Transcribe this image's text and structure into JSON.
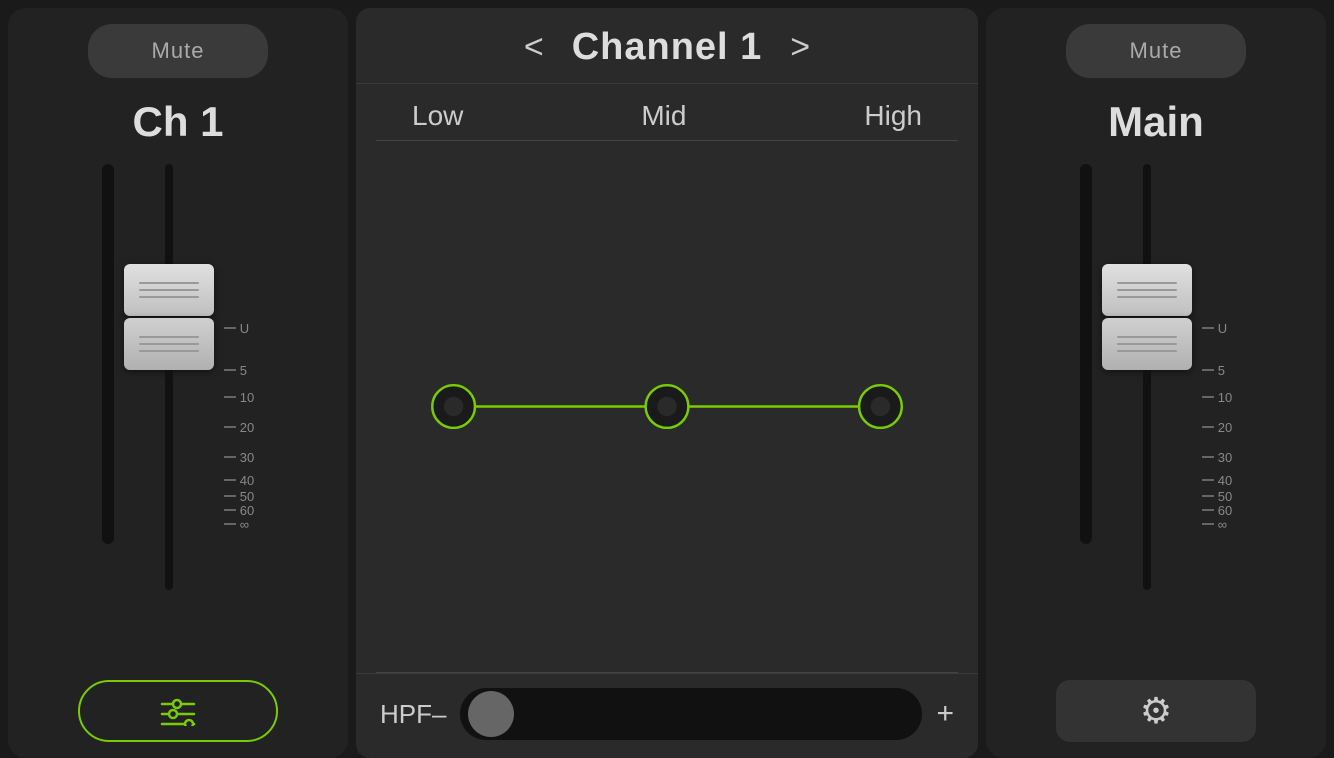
{
  "left_panel": {
    "mute_label": "Mute",
    "channel_label": "Ch 1",
    "eq_button_label": "|||",
    "scale_marks": [
      "U",
      "5",
      "10",
      "20",
      "30",
      "40",
      "50",
      "60",
      "∞"
    ]
  },
  "center_panel": {
    "prev_arrow": "<",
    "next_arrow": ">",
    "channel_title": "Channel 1",
    "eq_bands": {
      "low_label": "Low",
      "mid_label": "Mid",
      "high_label": "High"
    },
    "hpf_label": "HPF–",
    "hpf_plus": "+"
  },
  "right_panel": {
    "mute_label": "Mute",
    "channel_label": "Main",
    "gear_button_label": "⚙",
    "scale_marks": [
      "U",
      "5",
      "10",
      "20",
      "30",
      "40",
      "50",
      "60",
      "∞"
    ]
  }
}
